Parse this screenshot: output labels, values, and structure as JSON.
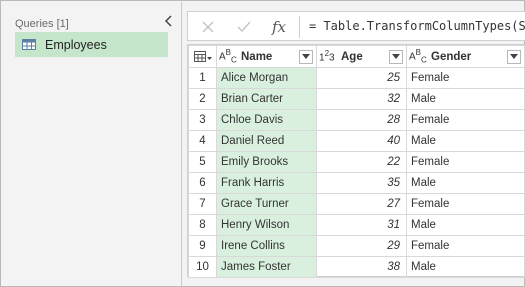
{
  "queries_pane": {
    "title": "Queries [1]",
    "items": [
      {
        "label": "Employees"
      }
    ]
  },
  "formula_bar": {
    "formula": "= Table.TransformColumnTypes(Sour",
    "fx_label": "fx"
  },
  "grid": {
    "columns": [
      {
        "label": "Name",
        "type_icon": "text-type-icon"
      },
      {
        "label": "Age",
        "type_icon": "number-type-icon"
      },
      {
        "label": "Gender",
        "type_icon": "text-type-icon"
      }
    ],
    "rows": [
      {
        "n": "1",
        "name": "Alice Morgan",
        "age": "25",
        "gender": "Female"
      },
      {
        "n": "2",
        "name": "Brian Carter",
        "age": "32",
        "gender": "Male"
      },
      {
        "n": "3",
        "name": "Chloe Davis",
        "age": "28",
        "gender": "Female"
      },
      {
        "n": "4",
        "name": "Daniel Reed",
        "age": "40",
        "gender": "Male"
      },
      {
        "n": "5",
        "name": "Emily Brooks",
        "age": "22",
        "gender": "Female"
      },
      {
        "n": "6",
        "name": "Frank Harris",
        "age": "35",
        "gender": "Male"
      },
      {
        "n": "7",
        "name": "Grace Turner",
        "age": "27",
        "gender": "Female"
      },
      {
        "n": "8",
        "name": "Henry Wilson",
        "age": "31",
        "gender": "Male"
      },
      {
        "n": "9",
        "name": "Irene Collins",
        "age": "29",
        "gender": "Female"
      },
      {
        "n": "10",
        "name": "James Foster",
        "age": "38",
        "gender": "Male"
      }
    ]
  },
  "colors": {
    "selected_query_bg": "#c6e6cc",
    "selected_column_bg": "#daf0df",
    "pane_bg": "#f3f3f3"
  }
}
